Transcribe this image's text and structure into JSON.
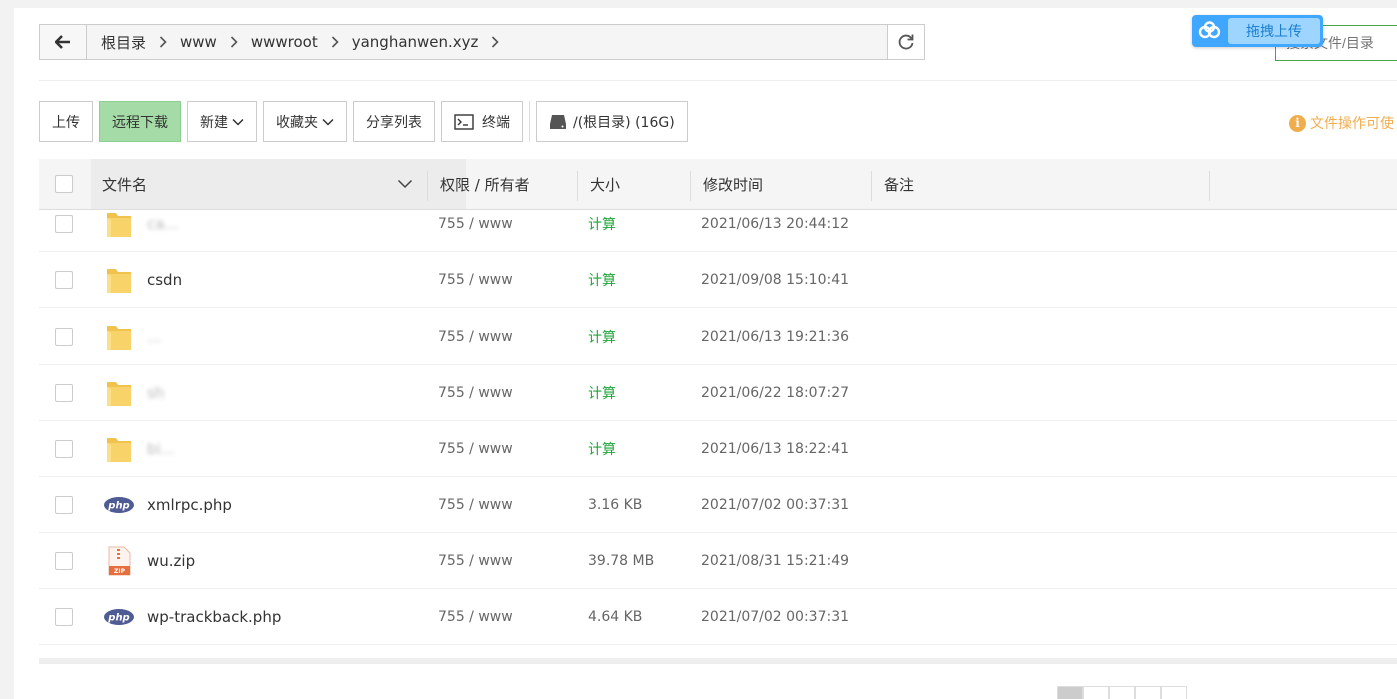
{
  "path": {
    "crumbs": [
      "根目录",
      "www",
      "wwwroot",
      "yanghanwen.xyz"
    ]
  },
  "search": {
    "placeholder": "搜索文件/目录"
  },
  "cloud_upload": {
    "label": "拖拽上传"
  },
  "toolbar": {
    "upload": "上传",
    "remote_download": "远程下载",
    "new": "新建",
    "favorites": "收藏夹",
    "share_list": "分享列表",
    "terminal": "终端",
    "disk": "/(根目录) (16G)"
  },
  "tip": {
    "text": "文件操作可使"
  },
  "table": {
    "headers": {
      "name": "文件名",
      "perm": "权限 / 所有者",
      "size": "大小",
      "mtime": "修改时间",
      "note": "备注"
    },
    "rows": [
      {
        "icon": "folder",
        "name": "ca...",
        "perm": "755 / www",
        "size": "计算",
        "mtime": "2021/06/13 20:44:12",
        "blurred": true
      },
      {
        "icon": "folder",
        "name": "csdn",
        "perm": "755 / www",
        "size": "计算",
        "mtime": "2021/09/08 15:10:41",
        "blurred": false
      },
      {
        "icon": "folder",
        "name": "...",
        "perm": "755 / www",
        "size": "计算",
        "mtime": "2021/06/13 19:21:36",
        "blurred": true
      },
      {
        "icon": "folder",
        "name": "sh",
        "perm": "755 / www",
        "size": "计算",
        "mtime": "2021/06/22 18:07:27",
        "blurred": true
      },
      {
        "icon": "folder",
        "name": "bi...",
        "perm": "755 / www",
        "size": "计算",
        "mtime": "2021/06/13 18:22:41",
        "blurred": true
      },
      {
        "icon": "php",
        "name": "xmlrpc.php",
        "perm": "755 / www",
        "size": "3.16 KB",
        "mtime": "2021/07/02 00:37:31",
        "blurred": false
      },
      {
        "icon": "zip",
        "name": "wu.zip",
        "perm": "755 / www",
        "size": "39.78 MB",
        "mtime": "2021/08/31 15:21:49",
        "blurred": false
      },
      {
        "icon": "php",
        "name": "wp-trackback.php",
        "perm": "755 / www",
        "size": "4.64 KB",
        "mtime": "2021/07/02 00:37:31",
        "blurred": false
      }
    ]
  },
  "colors": {
    "accent_green": "#20a53a",
    "button_green": "#a4dba6",
    "warning_orange": "#f0ad4e",
    "cloud_blue": "#3fa7ff",
    "folder_yellow": "#f7d36a"
  }
}
